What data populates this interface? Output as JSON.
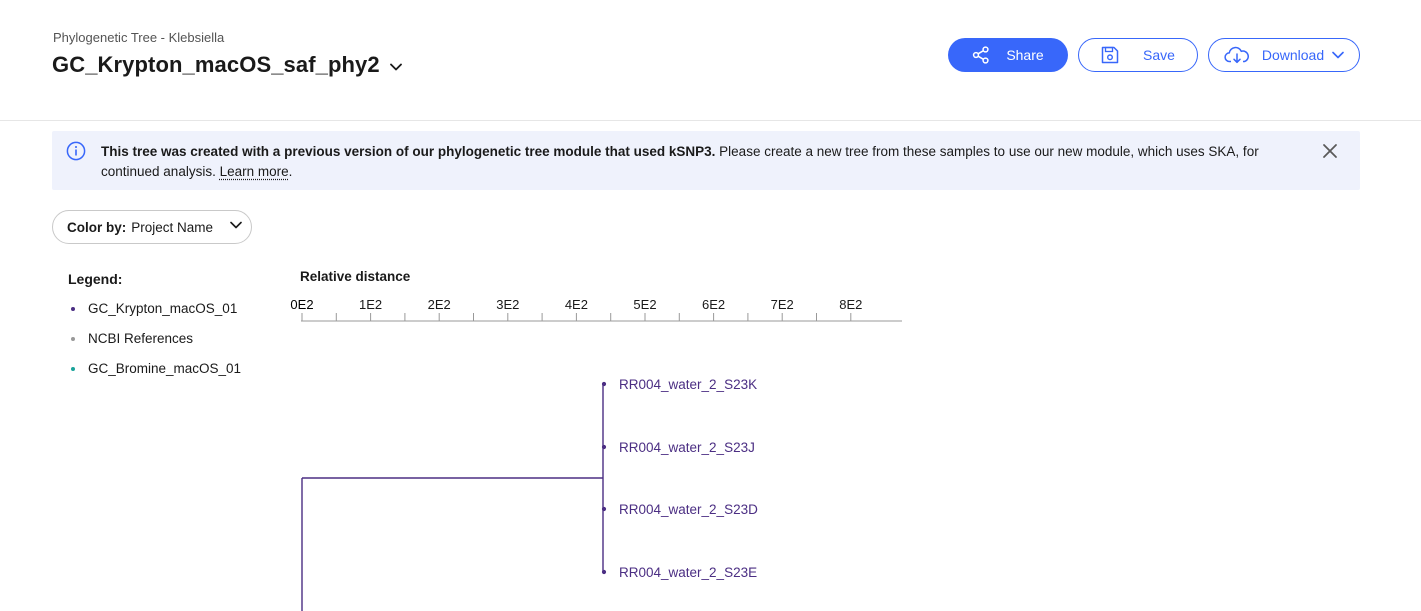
{
  "header": {
    "breadcrumb": "Phylogenetic Tree - Klebsiella",
    "title": "GC_Krypton_macOS_saf_phy2",
    "share_label": "Share",
    "save_label": "Save",
    "download_label": "Download"
  },
  "banner": {
    "bold_text": "This tree was created with a previous version of our phylogenetic tree module that used kSNP3.",
    "text": " Please create a new tree from these samples to use our new module, which uses SKA, for continued analysis. ",
    "link_label": "Learn more",
    "trailing": "."
  },
  "color_by": {
    "label": "Color by:",
    "value": "Project Name"
  },
  "legend": {
    "title": "Legend:",
    "items": [
      {
        "label": "GC_Krypton_macOS_01",
        "color": "#4b2e83"
      },
      {
        "label": "NCBI References",
        "color": "#999999"
      },
      {
        "label": "GC_Bromine_macOS_01",
        "color": "#1aa39a"
      }
    ]
  },
  "tree": {
    "axis_title": "Relative distance",
    "axis_ticks": [
      "0E2",
      "1E2",
      "2E2",
      "3E2",
      "4E2",
      "5E2",
      "6E2",
      "7E2",
      "8E2"
    ],
    "leaves": [
      "RR004_water_2_S23K",
      "RR004_water_2_S23J",
      "RR004_water_2_S23D",
      "RR004_water_2_S23E"
    ],
    "branch_color": "#4b2e83"
  },
  "icons": {
    "share": "share-icon",
    "save": "save-icon",
    "download": "cloud-download-icon",
    "info": "info-icon",
    "close": "close-icon",
    "chevron": "chevron-down-icon"
  }
}
